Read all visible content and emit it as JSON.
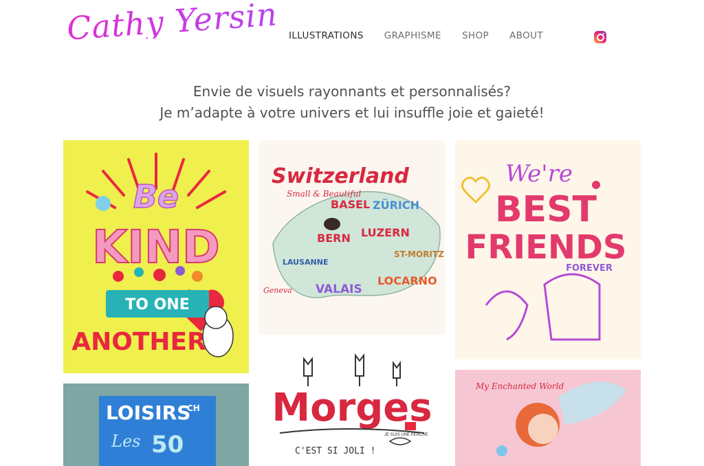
{
  "brand": {
    "logo_text": "Cathy Yersin"
  },
  "nav": {
    "items": [
      {
        "label": "ILLUSTRATIONS",
        "active": true
      },
      {
        "label": "GRAPHISME",
        "active": false
      },
      {
        "label": "SHOP",
        "active": false
      },
      {
        "label": "ABOUT",
        "active": false
      }
    ],
    "social_icon": "instagram-icon"
  },
  "tagline": {
    "line1": "Envie de visuels rayonnants et personnalisés?",
    "line2": "Je m’adapte à votre univers et lui insuffle joie et gaieté!"
  },
  "gallery": {
    "be_kind": {
      "w1": "Be",
      "w2": "KIND",
      "w3": "TO ONE",
      "w4": "ANOTHER"
    },
    "switzerland": {
      "title": "Switzerland",
      "subtitle": "Small & Beautiful",
      "places": [
        "BASEL",
        "ZÜRICH",
        "BERN",
        "LUZERN",
        "LAUSANNE",
        "ST-MORITZ",
        "VALAIS",
        "LOCARNO",
        "Geneva"
      ]
    },
    "best_friends": {
      "w1": "We're",
      "w2": "BEST",
      "w3": "FRIENDS",
      "w4": "FOREVER"
    },
    "loisirs": {
      "title": "LOISIRS",
      "suffix": "CH",
      "l1": "Les",
      "l2": "50"
    },
    "morges": {
      "title": "Morges",
      "tagline": "C'EST SI JOLI !",
      "badge": "JE SUIS UNE PERCHE"
    },
    "enchanted": {
      "title": "My Enchanted World"
    }
  },
  "colors": {
    "logo": "#d935d8",
    "be_kind_bg": "#efef4d",
    "accent_pink": "#e23a8a",
    "accent_teal": "#27b3b5",
    "switzerland_red": "#d8283f"
  }
}
